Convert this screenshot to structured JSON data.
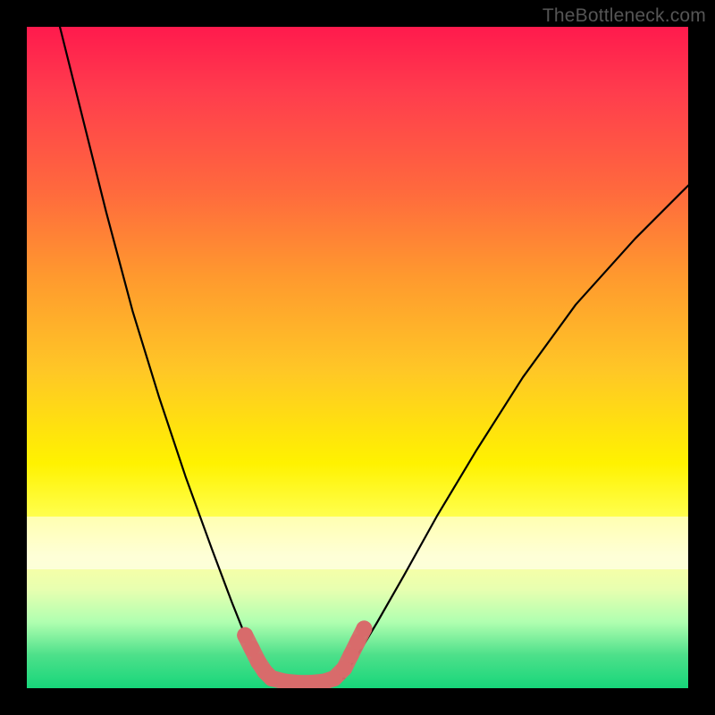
{
  "watermark": "TheBottleneck.com",
  "colors": {
    "frame": "#000000",
    "gradient_top": "#ff1a4d",
    "gradient_mid": "#fff200",
    "gradient_bottom": "#17d67a",
    "curve": "#000000",
    "marker": "#d86b6b"
  },
  "chart_data": {
    "type": "line",
    "title": "",
    "xlabel": "",
    "ylabel": "",
    "xlim": [
      0,
      100
    ],
    "ylim": [
      0,
      100
    ],
    "grid": false,
    "legend": false,
    "series": [
      {
        "name": "left-curve",
        "x": [
          5,
          8,
          12,
          16,
          20,
          24,
          28,
          31,
          33,
          35,
          36
        ],
        "y": [
          100,
          88,
          72,
          57,
          44,
          32,
          21,
          13,
          8,
          4,
          2
        ]
      },
      {
        "name": "right-curve",
        "x": [
          48,
          50,
          53,
          57,
          62,
          68,
          75,
          83,
          92,
          100
        ],
        "y": [
          2,
          5,
          10,
          17,
          26,
          36,
          47,
          58,
          68,
          76
        ]
      },
      {
        "name": "valley-floor",
        "x": [
          36,
          39,
          42,
          45,
          48
        ],
        "y": [
          1.5,
          0.8,
          0.6,
          0.8,
          1.5
        ]
      }
    ],
    "markers": {
      "name": "highlight-segments",
      "color": "#d86b6b",
      "points": [
        {
          "x": 33,
          "y": 8
        },
        {
          "x": 34,
          "y": 6
        },
        {
          "x": 35,
          "y": 4
        },
        {
          "x": 36,
          "y": 2.5
        },
        {
          "x": 37,
          "y": 1.5
        },
        {
          "x": 39,
          "y": 1
        },
        {
          "x": 41,
          "y": 0.8
        },
        {
          "x": 43,
          "y": 0.8
        },
        {
          "x": 45,
          "y": 1
        },
        {
          "x": 46.5,
          "y": 1.5
        },
        {
          "x": 48,
          "y": 3
        },
        {
          "x": 49,
          "y": 5
        },
        {
          "x": 50,
          "y": 7
        },
        {
          "x": 51,
          "y": 9
        }
      ]
    }
  }
}
